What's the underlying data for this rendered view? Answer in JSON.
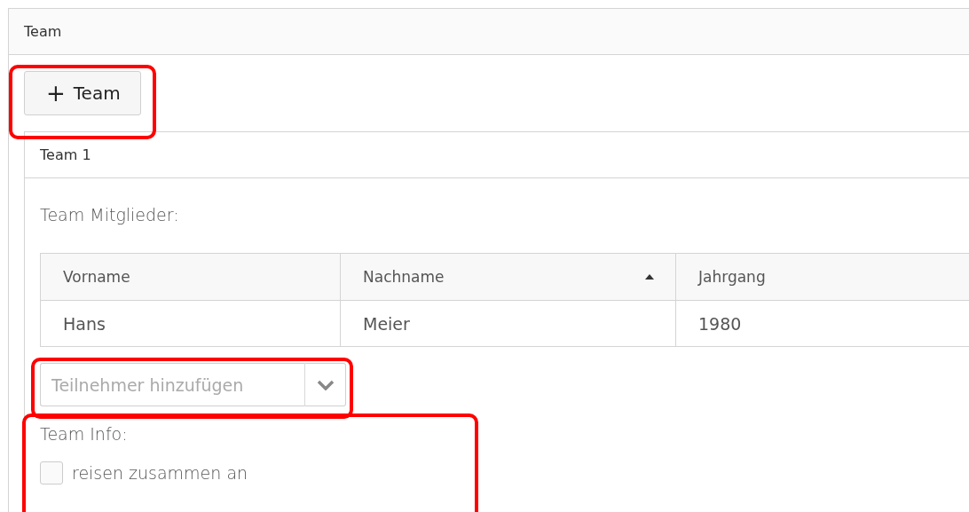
{
  "panel": {
    "title": "Team"
  },
  "add_team_button": {
    "icon": "+",
    "label": "Team",
    "highlighted": true
  },
  "team": {
    "title": "Team 1",
    "members_label": "Team Mitglieder:",
    "table": {
      "columns": [
        {
          "label": "Vorname",
          "sorted": false
        },
        {
          "label": "Nachname",
          "sorted": true
        },
        {
          "label": "Jahrgang",
          "sorted": false
        }
      ],
      "rows": [
        [
          "Hans",
          "Meier",
          "1980"
        ]
      ]
    },
    "add_member": {
      "placeholder": "Teilnehmer hinzufügen",
      "highlighted": true
    },
    "info": {
      "label": "Team Info:",
      "highlighted": true,
      "checkboxes": [
        {
          "label": "reisen zusammen an",
          "checked": false
        }
      ]
    }
  }
}
